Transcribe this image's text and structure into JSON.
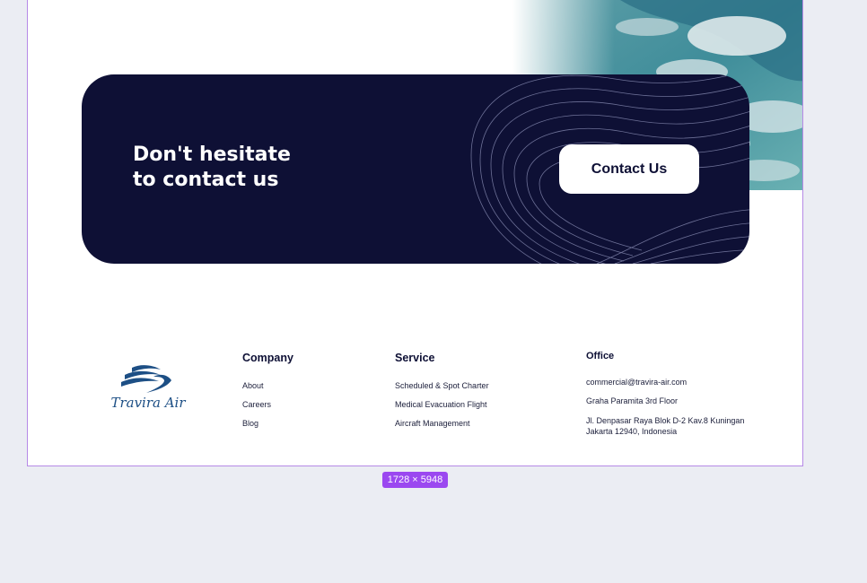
{
  "cta": {
    "title_line1": "Don't hesitate",
    "title_line2": "to contact us",
    "button_label": "Contact Us"
  },
  "logo": {
    "text": "Travira Air"
  },
  "footer": {
    "company": {
      "title": "Company",
      "links": [
        "About",
        "Careers",
        "Blog"
      ]
    },
    "service": {
      "title": "Service",
      "links": [
        "Scheduled & Spot Charter",
        "Medical Evacuation Flight",
        "Aircraft Management"
      ]
    },
    "office": {
      "title": "Office",
      "email": "commercial@travira-air.com",
      "building": "Graha Paramita 3rd Floor",
      "address_line1": "Jl. Denpasar Raya Blok D-2 Kav.8 Kuningan",
      "address_line2": "Jakarta 12940, Indonesia"
    }
  },
  "frame_size_label": "1728 × 5948",
  "colors": {
    "banner": "#0e1035",
    "frame_border": "#b68ae6",
    "badge": "#9b48f0",
    "logo": "#1d4f85"
  }
}
